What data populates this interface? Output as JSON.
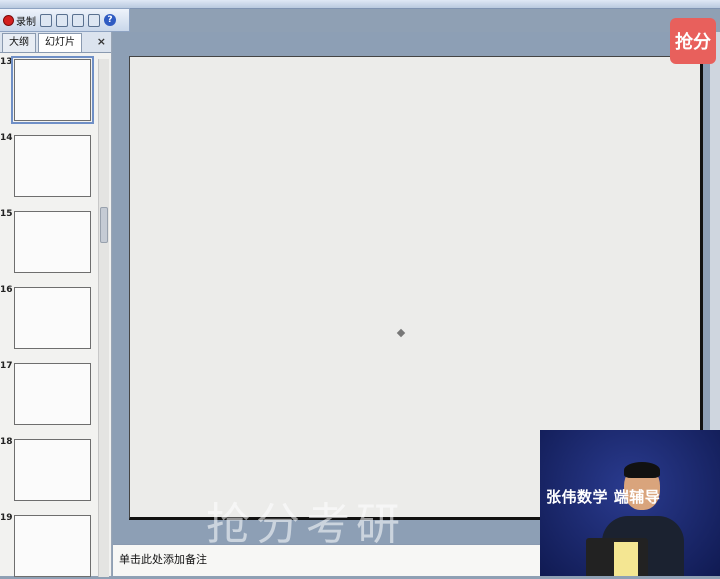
{
  "toolbar": {
    "record_label": "录制"
  },
  "left_pane": {
    "tabs": [
      {
        "label": "大纲"
      },
      {
        "label": "幻灯片"
      }
    ],
    "close_label": "×",
    "slides": [
      {
        "number": "13",
        "selected": true
      },
      {
        "number": "14"
      },
      {
        "number": "15"
      },
      {
        "number": "16"
      },
      {
        "number": "17"
      },
      {
        "number": "18"
      },
      {
        "number": "19"
      }
    ]
  },
  "notes": {
    "placeholder": "单击此处添加备注"
  },
  "watermark": "抢分考研",
  "logo_text": "抢分",
  "video": {
    "title": "张伟数学 端辅导"
  }
}
